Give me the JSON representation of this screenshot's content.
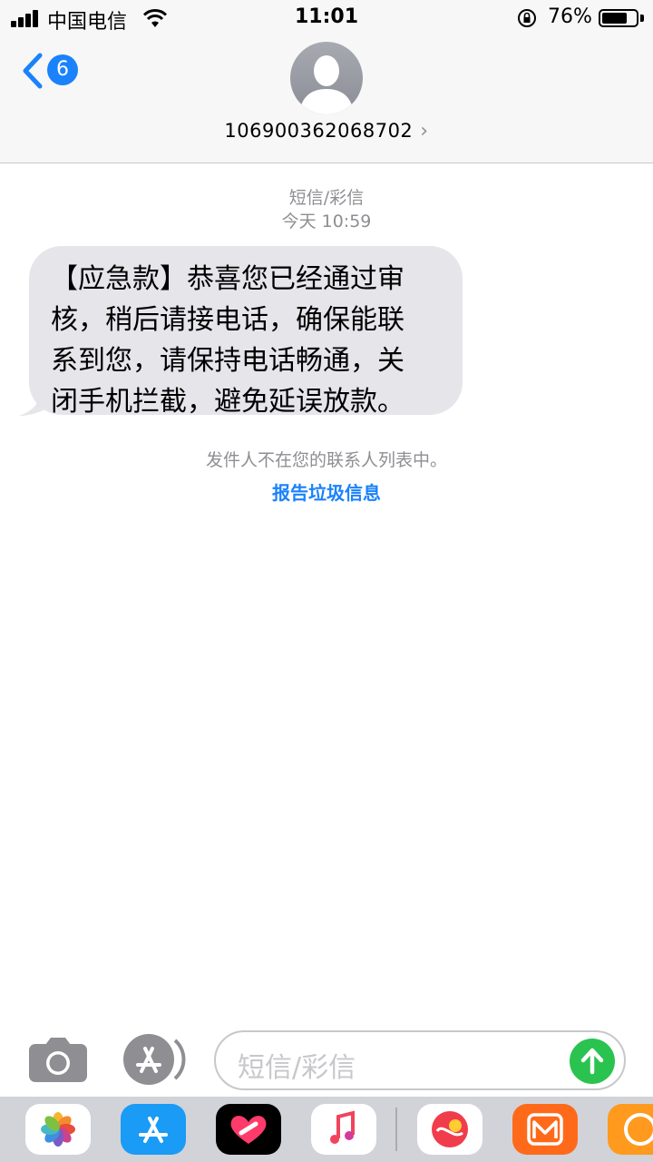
{
  "status_bar": {
    "carrier": "中国电信",
    "time": "11:01",
    "battery_percent": "76%",
    "battery_level": 0.76
  },
  "header": {
    "back_count": "6",
    "contact": "106900362068702"
  },
  "conversation": {
    "message_type": "短信/彩信",
    "timestamp": "今天 10:59",
    "message_lines": [
      "【应急款】恭喜您已经通过审",
      "核，稍后请接电话，确保能联",
      "系到您，请保持电话畅通，关",
      "闭手机拦截，避免延误放款。"
    ],
    "sender_note": "发件人不在您的联系人列表中。",
    "report_link": "报告垃圾信息"
  },
  "input_bar": {
    "placeholder": "短信/彩信"
  },
  "app_drawer": {
    "apps": [
      "photos-icon",
      "app-store-icon",
      "digital-touch-icon",
      "music-icon",
      "app-icon",
      "mango-tv-icon",
      "uc-browser-icon"
    ]
  },
  "colors": {
    "accent": "#1a82fb",
    "bubble": "#e5e5ea",
    "send": "#2ac34f",
    "secondary_text": "#8e8e93"
  }
}
